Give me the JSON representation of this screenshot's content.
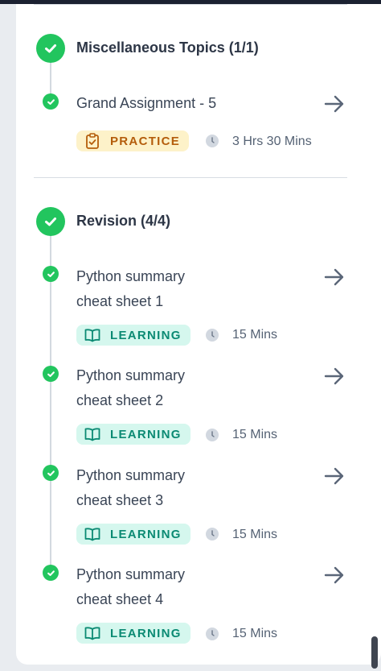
{
  "sections": [
    {
      "title": "Miscellaneous Topics (1/1)",
      "items": [
        {
          "title": "Grand Assignment - 5",
          "badge": "PRACTICE",
          "duration": "3 Hrs 30 Mins"
        }
      ]
    },
    {
      "title": "Revision (4/4)",
      "items": [
        {
          "title": "Python summary cheat sheet 1",
          "badge": "LEARNING",
          "duration": "15 Mins"
        },
        {
          "title": "Python summary cheat sheet 2",
          "badge": "LEARNING",
          "duration": "15 Mins"
        },
        {
          "title": "Python summary cheat sheet 3",
          "badge": "LEARNING",
          "duration": "15 Mins"
        },
        {
          "title": "Python summary cheat sheet 4",
          "badge": "LEARNING",
          "duration": "15 Mins"
        }
      ]
    }
  ],
  "colors": {
    "complete_green": "#22c55e",
    "practice_bg": "#fdf2c9",
    "practice_text": "#b45d0c",
    "learning_bg": "#d5f7ee",
    "learning_text": "#0b8a73"
  },
  "icons": {
    "section_status": "check-circle-icon",
    "item_status": "check-circle-icon",
    "open": "arrow-right-icon",
    "practice": "clipboard-check-icon",
    "learning": "open-book-icon",
    "duration": "clock-icon"
  }
}
